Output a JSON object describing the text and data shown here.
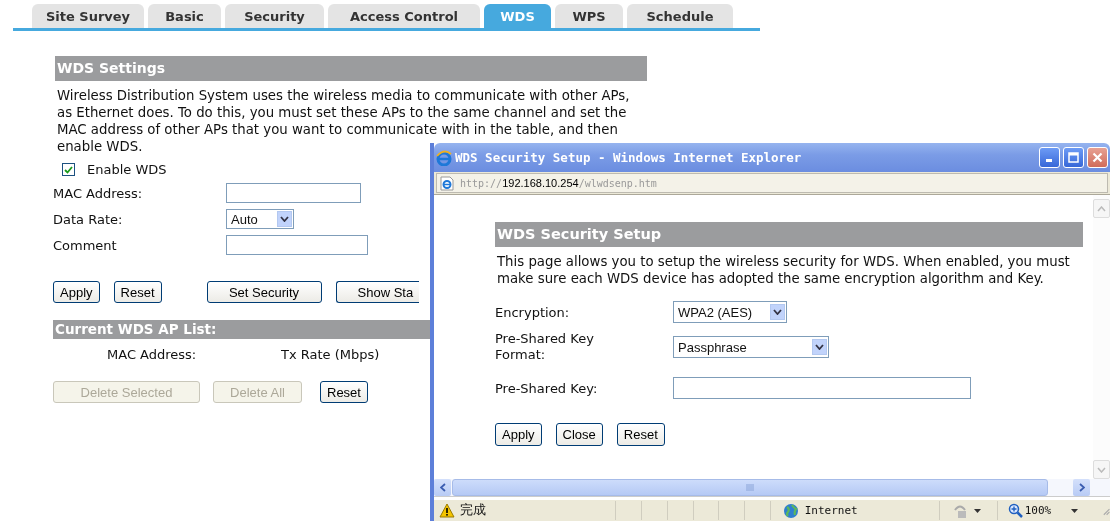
{
  "tabs": [
    {
      "label": "Site Survey",
      "selected": false
    },
    {
      "label": "Basic",
      "selected": false
    },
    {
      "label": "Security",
      "selected": false
    },
    {
      "label": "Access Control",
      "selected": false
    },
    {
      "label": "WDS",
      "selected": true
    },
    {
      "label": "WPS",
      "selected": false
    },
    {
      "label": "Schedule",
      "selected": false
    }
  ],
  "wds_settings": {
    "title": "WDS Settings",
    "description": "Wireless Distribution System uses the wireless media to communicate with other APs, as Ethernet does. To do this, you must set these APs to the same channel and set the MAC address of other APs that you want to communicate with in the table, and then enable WDS.",
    "enable_wds": {
      "label": "Enable WDS",
      "checked": true
    },
    "fields": [
      {
        "kind": "text",
        "label": "MAC Address:"
      },
      {
        "kind": "select",
        "label": "Data Rate:",
        "value": "Auto"
      },
      {
        "kind": "text",
        "label": "Comment"
      }
    ],
    "button_groups": [
      [
        {
          "label": "Apply",
          "disabled": false
        },
        {
          "label": "Reset",
          "disabled": false
        }
      ],
      [
        {
          "label": "Set Security",
          "disabled": false
        },
        {
          "label": "Show Sta",
          "disabled": false
        }
      ]
    ]
  },
  "ap_list": {
    "title": "Current WDS AP List:",
    "columns": [
      "MAC Address:",
      "Tx Rate (Mbps)"
    ],
    "buttons": [
      {
        "label": "Delete Selected",
        "disabled": true
      },
      {
        "label": "Delete All",
        "disabled": true
      },
      {
        "label": "Reset",
        "disabled": false
      }
    ]
  },
  "popup": {
    "title": "WDS Security Setup - Windows Internet Explorer",
    "address": {
      "scheme": "http://",
      "host": "192.168.10.254",
      "path": "/wlwdsenp.htm"
    },
    "heading": "WDS Security Setup",
    "description": "This page allows you to setup the wireless security for WDS. When enabled, you must make sure each WDS device has adopted the same encryption algorithm and Key.",
    "fields": [
      {
        "kind": "select",
        "label": "Encryption:",
        "value": "WPA2 (AES)"
      },
      {
        "kind": "select",
        "label": "Pre-Shared Key Format:",
        "value": "Passphrase"
      },
      {
        "kind": "text",
        "label": "Pre-Shared Key:"
      }
    ],
    "buttons": [
      {
        "label": "Apply",
        "disabled": false
      },
      {
        "label": "Close",
        "disabled": false
      },
      {
        "label": "Reset",
        "disabled": false
      }
    ],
    "status_bar": {
      "text": "完成",
      "zone": "Internet",
      "zoom": "100%"
    }
  }
}
